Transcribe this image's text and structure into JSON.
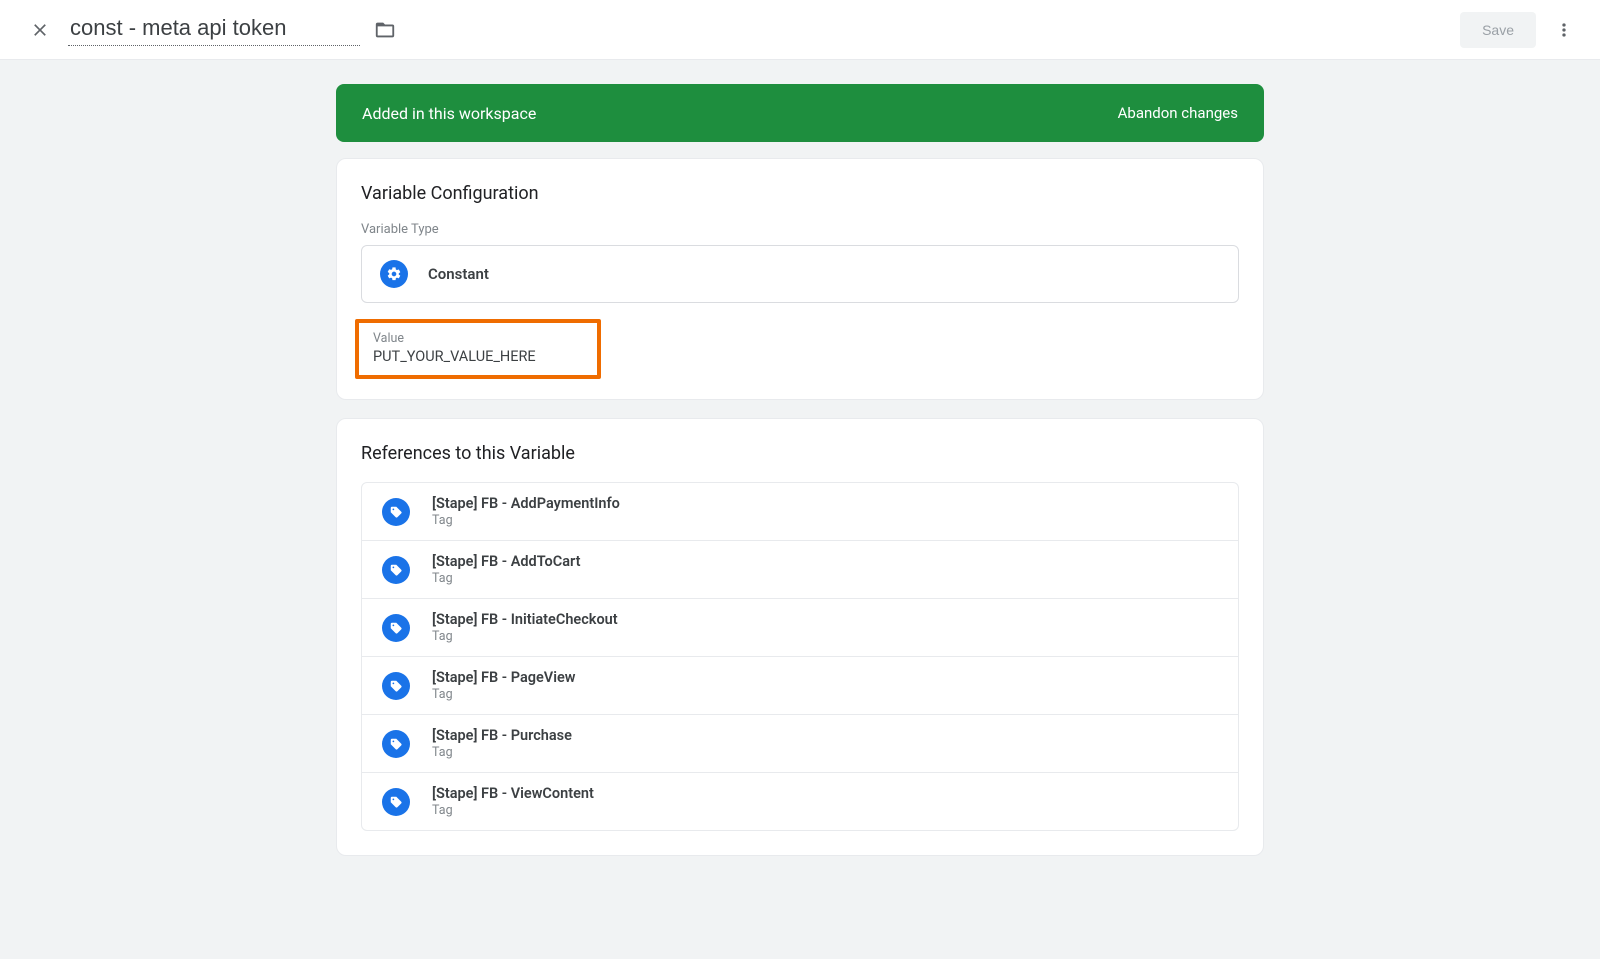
{
  "header": {
    "title": "const - meta api token",
    "save_label": "Save"
  },
  "banner": {
    "message": "Added in this workspace",
    "action": "Abandon changes"
  },
  "config": {
    "heading": "Variable Configuration",
    "type_label": "Variable Type",
    "type_name": "Constant",
    "value_label": "Value",
    "value": "PUT_YOUR_VALUE_HERE"
  },
  "refs": {
    "heading": "References to this Variable",
    "items": [
      {
        "name": "[Stape] FB - AddPaymentInfo",
        "type": "Tag"
      },
      {
        "name": "[Stape] FB - AddToCart",
        "type": "Tag"
      },
      {
        "name": "[Stape] FB - InitiateCheckout",
        "type": "Tag"
      },
      {
        "name": "[Stape] FB - PageView",
        "type": "Tag"
      },
      {
        "name": "[Stape] FB - Purchase",
        "type": "Tag"
      },
      {
        "name": "[Stape] FB - ViewContent",
        "type": "Tag"
      }
    ]
  }
}
